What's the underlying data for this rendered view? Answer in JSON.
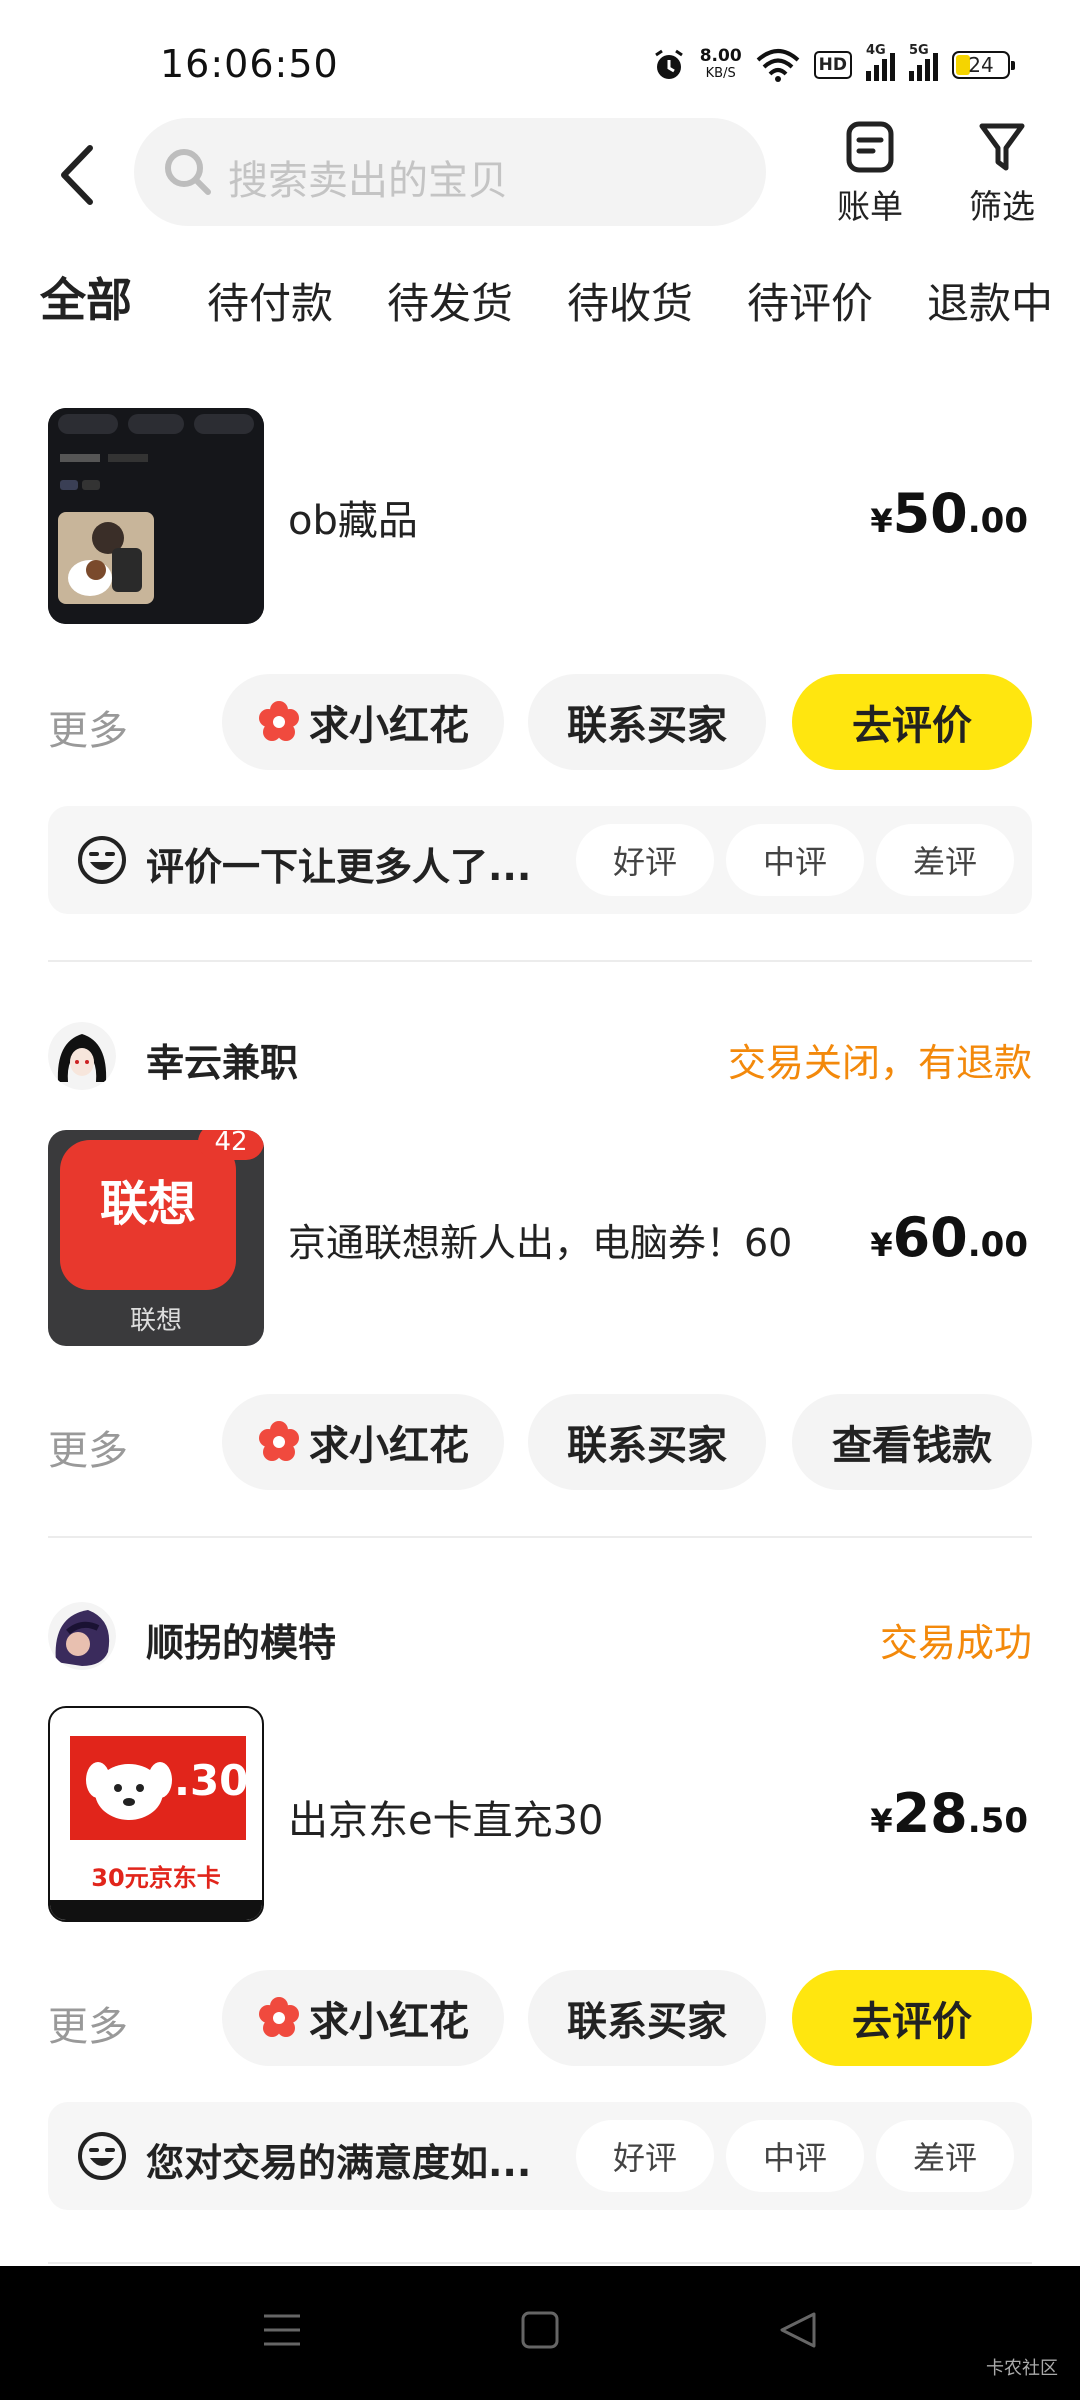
{
  "status_bar": {
    "time": "16:06:50",
    "net_speed": "8.00",
    "net_unit": "KB/S",
    "hd_label": "HD",
    "signal1": "4G",
    "signal2": "5G",
    "battery": "24"
  },
  "header": {
    "search_placeholder": "搜索卖出的宝贝",
    "bill_label": "账单",
    "filter_label": "筛选"
  },
  "tabs": [
    "全部",
    "待付款",
    "待发货",
    "待收货",
    "待评价",
    "退款中"
  ],
  "orders": [
    {
      "product_title": "ob藏品",
      "price_symbol": "¥",
      "price_int": "50",
      "price_dec": ".00",
      "more": "更多",
      "flower_btn": "求小红花",
      "contact_btn": "联系买家",
      "primary_btn": "去评价",
      "review_prompt": "评价一下让更多人了...",
      "review_good": "好评",
      "review_mid": "中评",
      "review_bad": "差评"
    },
    {
      "seller": "幸云兼职",
      "status": "交易关闭，有退款",
      "thumb_text": "联想",
      "thumb_caption": "联想",
      "thumb_badge": "42",
      "product_title": "京通联想新人出，电脑券！60",
      "price_symbol": "¥",
      "price_int": "60",
      "price_dec": ".00",
      "more": "更多",
      "flower_btn": "求小红花",
      "contact_btn": "联系买家",
      "primary_btn": "查看钱款"
    },
    {
      "seller": "顺拐的模特",
      "status": "交易成功",
      "thumb_value": ".30",
      "thumb_caption": "30元京东卡",
      "product_title": "出京东e卡直充30",
      "price_symbol": "¥",
      "price_int": "28",
      "price_dec": ".50",
      "more": "更多",
      "flower_btn": "求小红花",
      "contact_btn": "联系买家",
      "primary_btn": "去评价",
      "review_prompt": "您对交易的满意度如...",
      "review_good": "好评",
      "review_mid": "中评",
      "review_bad": "差评"
    }
  ],
  "watermark": "卡农社区",
  "colors": {
    "accent_yellow": "#ffe60f",
    "status_orange": "#f3890b",
    "flower_red": "#f04a3e"
  }
}
